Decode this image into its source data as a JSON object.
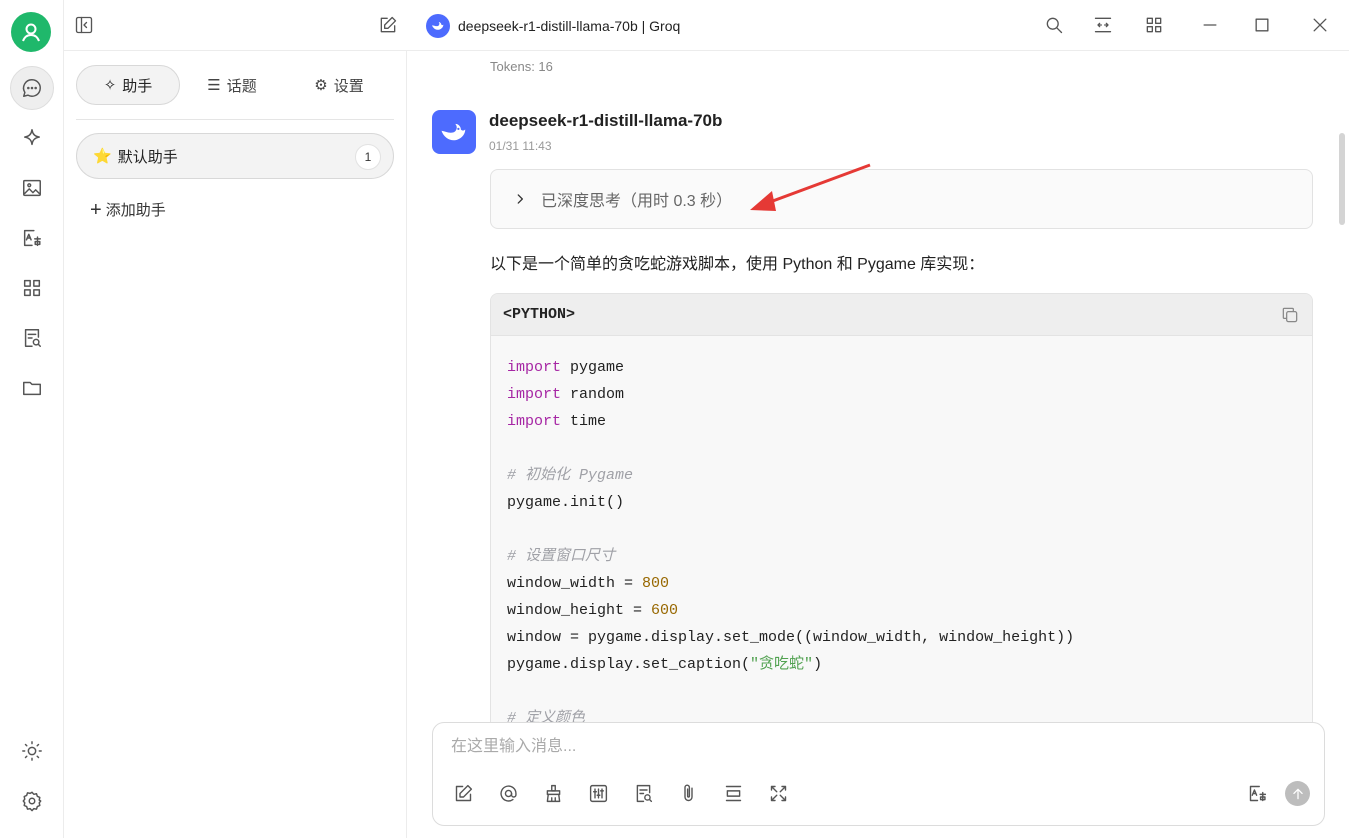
{
  "titlebar": {
    "title": "deepseek-r1-distill-llama-70b | Groq"
  },
  "sidebar_tabs": {
    "assistant": "助手",
    "topics": "话题",
    "settings": "设置"
  },
  "assistants": {
    "items": [
      {
        "label": "默认助手",
        "count": "1"
      }
    ],
    "add_label": "添加助手"
  },
  "chat": {
    "tokens": "Tokens: 16",
    "model_name": "deepseek-r1-distill-llama-70b",
    "time": "01/31 11:43",
    "thinking": "已深度思考（用时 0.3 秒）",
    "intro": "以下是一个简单的贪吃蛇游戏脚本，使用 Python 和 Pygame 库实现：",
    "code_lang": "<PYTHON>",
    "code": {
      "l1a": "import",
      "l1b": " pygame",
      "l2a": "import",
      "l2b": " random",
      "l3a": "import",
      "l3b": " time",
      "c1": "# 初始化 Pygame",
      "l5": "pygame.init()",
      "c2": "# 设置窗口尺寸",
      "l7a": "window_width = ",
      "l7b": "800",
      "l8a": "window_height = ",
      "l8b": "600",
      "l9": "window = pygame.display.set_mode((window_width, window_height))",
      "l10a": "pygame.display.set_caption(",
      "l10b": "\"贪吃蛇\"",
      "l10c": ")",
      "c3": "# 定义颜色"
    }
  },
  "input": {
    "placeholder": "在这里输入消息..."
  },
  "colors": {
    "accent_green": "#1fb86b",
    "model_blue": "#4d6bfe",
    "arrow_red": "#e53935"
  }
}
